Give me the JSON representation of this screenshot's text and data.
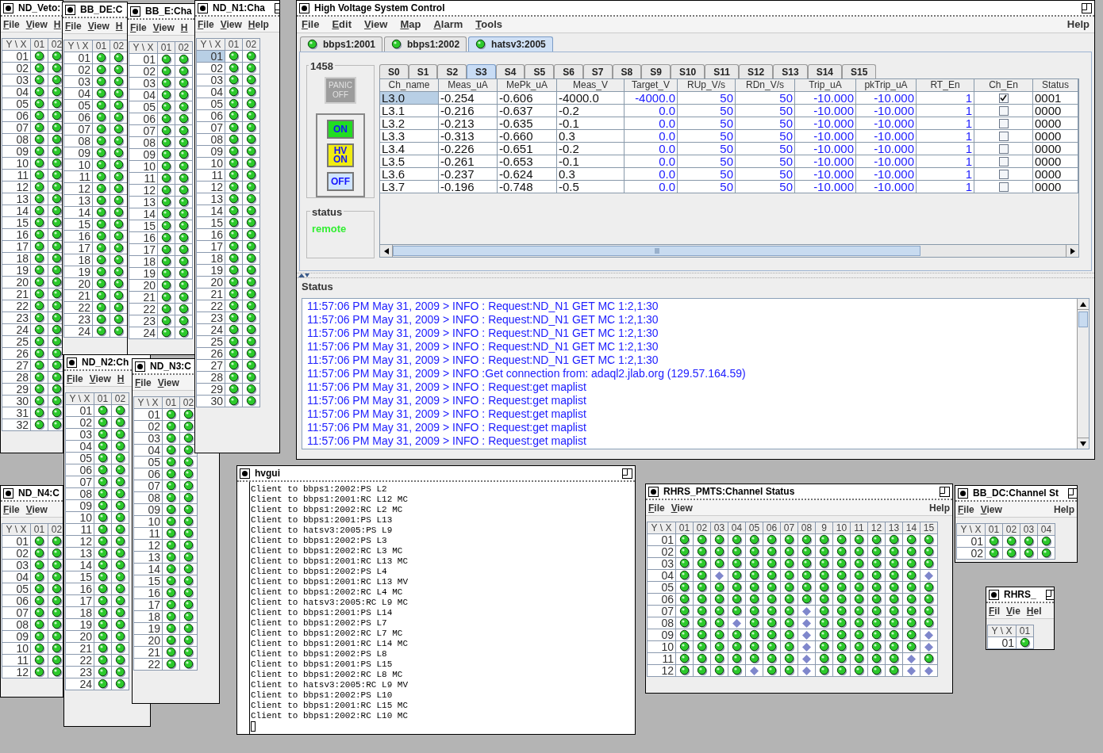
{
  "channel_windows": [
    {
      "title": "ND_Veto:",
      "menus": [
        "File",
        "View",
        "H"
      ],
      "corner": "Y \\ X",
      "columns": [
        "01",
        "02"
      ],
      "rows": [
        {
          "label": "01",
          "selected": false,
          "on": [
            true,
            true
          ]
        },
        {
          "label": "02",
          "selected": false,
          "on": [
            true,
            true
          ]
        },
        {
          "label": "03",
          "selected": false,
          "on": [
            true,
            true
          ]
        },
        {
          "label": "04",
          "selected": false,
          "on": [
            true,
            true
          ]
        },
        {
          "label": "05",
          "selected": false,
          "on": [
            true,
            true
          ]
        },
        {
          "label": "06",
          "selected": false,
          "on": [
            true,
            true
          ]
        },
        {
          "label": "07",
          "selected": false,
          "on": [
            true,
            true
          ]
        },
        {
          "label": "08",
          "selected": false,
          "on": [
            true,
            true
          ]
        },
        {
          "label": "09",
          "selected": false,
          "on": [
            true,
            true
          ]
        },
        {
          "label": "10",
          "selected": false,
          "on": [
            true,
            true
          ]
        },
        {
          "label": "11",
          "selected": false,
          "on": [
            true,
            true
          ]
        },
        {
          "label": "12",
          "selected": false,
          "on": [
            true,
            true
          ]
        },
        {
          "label": "13",
          "selected": false,
          "on": [
            true,
            true
          ]
        },
        {
          "label": "14",
          "selected": false,
          "on": [
            true,
            true
          ]
        },
        {
          "label": "15",
          "selected": false,
          "on": [
            true,
            true
          ]
        },
        {
          "label": "16",
          "selected": false,
          "on": [
            true,
            true
          ]
        },
        {
          "label": "17",
          "selected": false,
          "on": [
            true,
            true
          ]
        },
        {
          "label": "18",
          "selected": false,
          "on": [
            true,
            true
          ]
        },
        {
          "label": "19",
          "selected": false,
          "on": [
            true,
            true
          ]
        },
        {
          "label": "20",
          "selected": false,
          "on": [
            true,
            true
          ]
        },
        {
          "label": "21",
          "selected": false,
          "on": [
            true,
            true
          ]
        },
        {
          "label": "22",
          "selected": false,
          "on": [
            true,
            true
          ]
        },
        {
          "label": "23",
          "selected": false,
          "on": [
            true,
            true
          ]
        },
        {
          "label": "24",
          "selected": false,
          "on": [
            true,
            true
          ]
        },
        {
          "label": "25",
          "selected": false,
          "on": [
            true,
            true
          ]
        },
        {
          "label": "26",
          "selected": false,
          "on": [
            true,
            true
          ]
        },
        {
          "label": "27",
          "selected": false,
          "on": [
            true,
            true
          ]
        },
        {
          "label": "28",
          "selected": false,
          "on": [
            true,
            true
          ]
        },
        {
          "label": "29",
          "selected": false,
          "on": [
            true,
            true
          ]
        },
        {
          "label": "30",
          "selected": false,
          "on": [
            true,
            true
          ]
        },
        {
          "label": "31",
          "selected": false,
          "on": [
            true,
            true
          ]
        },
        {
          "label": "32",
          "selected": false,
          "on": [
            true,
            true
          ]
        }
      ]
    },
    {
      "title": "BB_DE:C",
      "menus": [
        "File",
        "View",
        "H"
      ],
      "corner": "Y \\ X",
      "columns": [
        "01",
        "02"
      ],
      "rows": [
        {
          "label": "01",
          "selected": false,
          "on": [
            true,
            true
          ]
        },
        {
          "label": "02",
          "selected": false,
          "on": [
            true,
            true
          ]
        },
        {
          "label": "03",
          "selected": false,
          "on": [
            true,
            true
          ]
        },
        {
          "label": "04",
          "selected": false,
          "on": [
            true,
            true
          ]
        },
        {
          "label": "05",
          "selected": false,
          "on": [
            true,
            true
          ]
        },
        {
          "label": "06",
          "selected": false,
          "on": [
            true,
            true
          ]
        },
        {
          "label": "07",
          "selected": false,
          "on": [
            true,
            true
          ]
        },
        {
          "label": "08",
          "selected": false,
          "on": [
            true,
            true
          ]
        },
        {
          "label": "09",
          "selected": false,
          "on": [
            true,
            true
          ]
        },
        {
          "label": "10",
          "selected": false,
          "on": [
            true,
            true
          ]
        },
        {
          "label": "11",
          "selected": false,
          "on": [
            true,
            true
          ]
        },
        {
          "label": "12",
          "selected": false,
          "on": [
            true,
            true
          ]
        },
        {
          "label": "13",
          "selected": false,
          "on": [
            true,
            true
          ]
        },
        {
          "label": "14",
          "selected": false,
          "on": [
            true,
            true
          ]
        },
        {
          "label": "15",
          "selected": false,
          "on": [
            true,
            true
          ]
        },
        {
          "label": "16",
          "selected": false,
          "on": [
            true,
            true
          ]
        },
        {
          "label": "17",
          "selected": false,
          "on": [
            true,
            true
          ]
        },
        {
          "label": "18",
          "selected": false,
          "on": [
            true,
            true
          ]
        },
        {
          "label": "19",
          "selected": false,
          "on": [
            true,
            true
          ]
        },
        {
          "label": "20",
          "selected": false,
          "on": [
            true,
            true
          ]
        },
        {
          "label": "21",
          "selected": false,
          "on": [
            true,
            true
          ]
        },
        {
          "label": "22",
          "selected": false,
          "on": [
            true,
            true
          ]
        },
        {
          "label": "23",
          "selected": false,
          "on": [
            true,
            true
          ]
        },
        {
          "label": "24",
          "selected": false,
          "on": [
            true,
            true
          ]
        }
      ]
    },
    {
      "title": "BB_E:Cha",
      "menus": [
        "File",
        "View",
        "H"
      ],
      "corner": "Y \\ X",
      "columns": [
        "01",
        "02"
      ],
      "rows": [
        {
          "label": "01",
          "selected": false,
          "on": [
            true,
            true
          ]
        },
        {
          "label": "02",
          "selected": false,
          "on": [
            true,
            true
          ]
        },
        {
          "label": "03",
          "selected": false,
          "on": [
            true,
            true
          ]
        },
        {
          "label": "04",
          "selected": false,
          "on": [
            true,
            true
          ]
        },
        {
          "label": "05",
          "selected": false,
          "on": [
            true,
            true
          ]
        },
        {
          "label": "06",
          "selected": false,
          "on": [
            true,
            true
          ]
        },
        {
          "label": "07",
          "selected": false,
          "on": [
            true,
            true
          ]
        },
        {
          "label": "08",
          "selected": false,
          "on": [
            true,
            true
          ]
        },
        {
          "label": "09",
          "selected": false,
          "on": [
            true,
            true
          ]
        },
        {
          "label": "10",
          "selected": false,
          "on": [
            true,
            true
          ]
        },
        {
          "label": "11",
          "selected": false,
          "on": [
            true,
            true
          ]
        },
        {
          "label": "12",
          "selected": false,
          "on": [
            true,
            true
          ]
        },
        {
          "label": "13",
          "selected": false,
          "on": [
            true,
            true
          ]
        },
        {
          "label": "14",
          "selected": false,
          "on": [
            true,
            true
          ]
        },
        {
          "label": "15",
          "selected": false,
          "on": [
            true,
            true
          ]
        },
        {
          "label": "16",
          "selected": false,
          "on": [
            true,
            true
          ]
        },
        {
          "label": "17",
          "selected": false,
          "on": [
            true,
            true
          ]
        },
        {
          "label": "18",
          "selected": false,
          "on": [
            true,
            true
          ]
        },
        {
          "label": "19",
          "selected": false,
          "on": [
            true,
            true
          ]
        },
        {
          "label": "20",
          "selected": false,
          "on": [
            true,
            true
          ]
        },
        {
          "label": "21",
          "selected": false,
          "on": [
            true,
            true
          ]
        },
        {
          "label": "22",
          "selected": false,
          "on": [
            true,
            true
          ]
        },
        {
          "label": "23",
          "selected": false,
          "on": [
            true,
            true
          ]
        },
        {
          "label": "24",
          "selected": false,
          "on": [
            true,
            true
          ]
        }
      ]
    },
    {
      "title": "ND_N1:Cha",
      "menus": [
        "File",
        "View",
        "Help"
      ],
      "corner": "Y \\ X",
      "columns": [
        "01",
        "02"
      ],
      "rows": [
        {
          "label": "01",
          "selected": true,
          "on": [
            true,
            true
          ]
        },
        {
          "label": "02",
          "selected": false,
          "on": [
            true,
            true
          ]
        },
        {
          "label": "03",
          "selected": false,
          "on": [
            true,
            true
          ]
        },
        {
          "label": "04",
          "selected": false,
          "on": [
            true,
            true
          ]
        },
        {
          "label": "05",
          "selected": false,
          "on": [
            true,
            true
          ]
        },
        {
          "label": "06",
          "selected": false,
          "on": [
            true,
            true
          ]
        },
        {
          "label": "07",
          "selected": false,
          "on": [
            true,
            true
          ]
        },
        {
          "label": "08",
          "selected": false,
          "on": [
            true,
            true
          ]
        },
        {
          "label": "09",
          "selected": false,
          "on": [
            true,
            true
          ]
        },
        {
          "label": "10",
          "selected": false,
          "on": [
            true,
            true
          ]
        },
        {
          "label": "11",
          "selected": false,
          "on": [
            true,
            true
          ]
        },
        {
          "label": "12",
          "selected": false,
          "on": [
            true,
            true
          ]
        },
        {
          "label": "13",
          "selected": false,
          "on": [
            true,
            true
          ]
        },
        {
          "label": "14",
          "selected": false,
          "on": [
            true,
            true
          ]
        },
        {
          "label": "15",
          "selected": false,
          "on": [
            true,
            true
          ]
        },
        {
          "label": "16",
          "selected": false,
          "on": [
            true,
            true
          ]
        },
        {
          "label": "17",
          "selected": false,
          "on": [
            true,
            true
          ]
        },
        {
          "label": "18",
          "selected": false,
          "on": [
            true,
            true
          ]
        },
        {
          "label": "19",
          "selected": false,
          "on": [
            true,
            true
          ]
        },
        {
          "label": "20",
          "selected": false,
          "on": [
            true,
            true
          ]
        },
        {
          "label": "21",
          "selected": false,
          "on": [
            true,
            true
          ]
        },
        {
          "label": "22",
          "selected": false,
          "on": [
            true,
            true
          ]
        },
        {
          "label": "23",
          "selected": false,
          "on": [
            true,
            true
          ]
        },
        {
          "label": "24",
          "selected": false,
          "on": [
            true,
            true
          ]
        },
        {
          "label": "25",
          "selected": false,
          "on": [
            true,
            true
          ]
        },
        {
          "label": "26",
          "selected": false,
          "on": [
            true,
            true
          ]
        },
        {
          "label": "27",
          "selected": false,
          "on": [
            true,
            true
          ]
        },
        {
          "label": "28",
          "selected": false,
          "on": [
            true,
            true
          ]
        },
        {
          "label": "29",
          "selected": false,
          "on": [
            true,
            true
          ]
        },
        {
          "label": "30",
          "selected": false,
          "on": [
            true,
            true
          ]
        }
      ]
    },
    {
      "title": "ND_N4:C",
      "menus": [
        "File",
        "View"
      ],
      "corner": "Y \\ X",
      "columns": [
        "01",
        "02"
      ],
      "rows": [
        {
          "label": "01",
          "selected": false,
          "on": [
            true,
            true
          ]
        },
        {
          "label": "02",
          "selected": false,
          "on": [
            true,
            true
          ]
        },
        {
          "label": "03",
          "selected": false,
          "on": [
            true,
            true
          ]
        },
        {
          "label": "04",
          "selected": false,
          "on": [
            true,
            true
          ]
        },
        {
          "label": "05",
          "selected": false,
          "on": [
            true,
            true
          ]
        },
        {
          "label": "06",
          "selected": false,
          "on": [
            true,
            true
          ]
        },
        {
          "label": "07",
          "selected": false,
          "on": [
            true,
            true
          ]
        },
        {
          "label": "08",
          "selected": false,
          "on": [
            true,
            true
          ]
        },
        {
          "label": "09",
          "selected": false,
          "on": [
            true,
            true
          ]
        },
        {
          "label": "10",
          "selected": false,
          "on": [
            true,
            true
          ]
        },
        {
          "label": "11",
          "selected": false,
          "on": [
            true,
            true
          ]
        },
        {
          "label": "12",
          "selected": false,
          "on": [
            true,
            true
          ]
        }
      ]
    },
    {
      "title": "ND_N2:Ch",
      "menus": [
        "File",
        "View",
        "H"
      ],
      "corner": "Y \\ X",
      "columns": [
        "01",
        "02"
      ],
      "rows": [
        {
          "label": "01",
          "selected": false,
          "on": [
            true,
            true
          ]
        },
        {
          "label": "02",
          "selected": false,
          "on": [
            true,
            true
          ]
        },
        {
          "label": "03",
          "selected": false,
          "on": [
            true,
            true
          ]
        },
        {
          "label": "04",
          "selected": false,
          "on": [
            true,
            true
          ]
        },
        {
          "label": "05",
          "selected": false,
          "on": [
            true,
            true
          ]
        },
        {
          "label": "06",
          "selected": false,
          "on": [
            true,
            true
          ]
        },
        {
          "label": "07",
          "selected": false,
          "on": [
            true,
            true
          ]
        },
        {
          "label": "08",
          "selected": false,
          "on": [
            true,
            true
          ]
        },
        {
          "label": "09",
          "selected": false,
          "on": [
            true,
            true
          ]
        },
        {
          "label": "10",
          "selected": false,
          "on": [
            true,
            true
          ]
        },
        {
          "label": "11",
          "selected": false,
          "on": [
            true,
            true
          ]
        },
        {
          "label": "12",
          "selected": false,
          "on": [
            true,
            true
          ]
        },
        {
          "label": "13",
          "selected": false,
          "on": [
            true,
            true
          ]
        },
        {
          "label": "14",
          "selected": false,
          "on": [
            true,
            true
          ]
        },
        {
          "label": "15",
          "selected": false,
          "on": [
            true,
            true
          ]
        },
        {
          "label": "16",
          "selected": false,
          "on": [
            true,
            true
          ]
        },
        {
          "label": "17",
          "selected": false,
          "on": [
            true,
            true
          ]
        },
        {
          "label": "18",
          "selected": false,
          "on": [
            true,
            true
          ]
        },
        {
          "label": "19",
          "selected": false,
          "on": [
            true,
            true
          ]
        },
        {
          "label": "20",
          "selected": false,
          "on": [
            true,
            true
          ]
        },
        {
          "label": "21",
          "selected": false,
          "on": [
            true,
            true
          ]
        },
        {
          "label": "22",
          "selected": false,
          "on": [
            true,
            true
          ]
        },
        {
          "label": "23",
          "selected": false,
          "on": [
            true,
            true
          ]
        },
        {
          "label": "24",
          "selected": false,
          "on": [
            true,
            true
          ]
        }
      ]
    },
    {
      "title": "ND_N3:C",
      "menus": [
        "File",
        "View"
      ],
      "corner": "Y \\ X",
      "columns": [
        "01",
        "02"
      ],
      "rows": [
        {
          "label": "01",
          "selected": false,
          "on": [
            true,
            true
          ]
        },
        {
          "label": "02",
          "selected": false,
          "on": [
            true,
            true
          ]
        },
        {
          "label": "03",
          "selected": false,
          "on": [
            true,
            true
          ]
        },
        {
          "label": "04",
          "selected": false,
          "on": [
            true,
            true
          ]
        },
        {
          "label": "05",
          "selected": false,
          "on": [
            true,
            true
          ]
        },
        {
          "label": "06",
          "selected": false,
          "on": [
            true,
            true
          ]
        },
        {
          "label": "07",
          "selected": false,
          "on": [
            true,
            true
          ]
        },
        {
          "label": "08",
          "selected": false,
          "on": [
            true,
            true
          ]
        },
        {
          "label": "09",
          "selected": false,
          "on": [
            true,
            true
          ]
        },
        {
          "label": "10",
          "selected": false,
          "on": [
            true,
            true
          ]
        },
        {
          "label": "11",
          "selected": false,
          "on": [
            true,
            true
          ]
        },
        {
          "label": "12",
          "selected": false,
          "on": [
            true,
            true
          ]
        },
        {
          "label": "13",
          "selected": false,
          "on": [
            true,
            true
          ]
        },
        {
          "label": "14",
          "selected": false,
          "on": [
            true,
            true
          ]
        },
        {
          "label": "15",
          "selected": false,
          "on": [
            true,
            true
          ]
        },
        {
          "label": "16",
          "selected": false,
          "on": [
            true,
            true
          ]
        },
        {
          "label": "17",
          "selected": false,
          "on": [
            true,
            true
          ]
        },
        {
          "label": "18",
          "selected": false,
          "on": [
            true,
            true
          ]
        },
        {
          "label": "19",
          "selected": false,
          "on": [
            true,
            true
          ]
        },
        {
          "label": "20",
          "selected": false,
          "on": [
            true,
            true
          ]
        },
        {
          "label": "21",
          "selected": false,
          "on": [
            true,
            true
          ]
        },
        {
          "label": "22",
          "selected": false,
          "on": [
            true,
            true
          ]
        }
      ]
    },
    {
      "title": "RHRS_PMTS:Channel Status",
      "menus": [
        "File",
        "View"
      ],
      "help": "Help",
      "corner": "Y \\ X",
      "columns": [
        "01",
        "02",
        "03",
        "04",
        "05",
        "06",
        "07",
        "08",
        "9",
        "10",
        "11",
        "12",
        "13",
        "14",
        "15"
      ],
      "rows": [
        {
          "label": "01",
          "selected": false,
          "on": [
            true,
            true,
            true,
            true,
            true,
            true,
            true,
            true,
            true,
            true,
            true,
            true,
            true,
            true,
            true
          ]
        },
        {
          "label": "02",
          "selected": false,
          "on": [
            true,
            true,
            true,
            true,
            true,
            true,
            true,
            true,
            true,
            true,
            true,
            true,
            true,
            true,
            true
          ]
        },
        {
          "label": "03",
          "selected": false,
          "on": [
            true,
            true,
            true,
            true,
            true,
            true,
            true,
            true,
            true,
            true,
            true,
            true,
            true,
            true,
            true
          ]
        },
        {
          "label": "04",
          "selected": false,
          "on": [
            true,
            true,
            false,
            true,
            true,
            true,
            true,
            true,
            true,
            true,
            true,
            true,
            true,
            true,
            false
          ]
        },
        {
          "label": "05",
          "selected": false,
          "on": [
            true,
            true,
            true,
            true,
            true,
            true,
            true,
            true,
            true,
            true,
            true,
            true,
            true,
            true,
            true
          ]
        },
        {
          "label": "06",
          "selected": false,
          "on": [
            true,
            true,
            true,
            true,
            true,
            true,
            true,
            true,
            true,
            true,
            true,
            true,
            true,
            true,
            true
          ]
        },
        {
          "label": "07",
          "selected": false,
          "on": [
            true,
            true,
            true,
            true,
            true,
            true,
            true,
            false,
            true,
            true,
            true,
            true,
            true,
            true,
            true
          ]
        },
        {
          "label": "08",
          "selected": false,
          "on": [
            true,
            true,
            true,
            false,
            true,
            true,
            true,
            false,
            true,
            true,
            true,
            true,
            true,
            true,
            true
          ]
        },
        {
          "label": "09",
          "selected": false,
          "on": [
            true,
            true,
            true,
            true,
            true,
            true,
            true,
            false,
            true,
            true,
            true,
            true,
            true,
            true,
            false
          ]
        },
        {
          "label": "10",
          "selected": false,
          "on": [
            true,
            true,
            true,
            true,
            true,
            true,
            true,
            false,
            true,
            true,
            true,
            true,
            true,
            true,
            false
          ]
        },
        {
          "label": "11",
          "selected": false,
          "on": [
            true,
            true,
            true,
            true,
            true,
            true,
            true,
            false,
            true,
            true,
            true,
            true,
            true,
            false,
            true
          ]
        },
        {
          "label": "12",
          "selected": false,
          "on": [
            true,
            true,
            true,
            true,
            false,
            true,
            true,
            false,
            true,
            true,
            true,
            true,
            true,
            false,
            false
          ]
        }
      ]
    },
    {
      "title": "BB_DC:Channel St",
      "menus": [
        "File",
        "View"
      ],
      "help": "Help",
      "corner": "Y \\ X",
      "columns": [
        "01",
        "02",
        "03",
        "04"
      ],
      "rows": [
        {
          "label": "01",
          "selected": false,
          "on": [
            true,
            true,
            true,
            true
          ]
        },
        {
          "label": "02",
          "selected": false,
          "on": [
            true,
            true,
            true,
            true
          ]
        }
      ]
    },
    {
      "title": "RHRS_",
      "menus": [
        "Fil",
        "Vie",
        "Hel"
      ],
      "corner": "Y \\ X",
      "columns": [
        "01"
      ],
      "rows": [
        {
          "label": "01",
          "selected": false,
          "on": [
            true
          ]
        }
      ]
    }
  ],
  "main_window": {
    "title": "High Voltage System Control",
    "menus": [
      "File",
      "Edit",
      "View",
      "Map",
      "Alarm",
      "Tools"
    ],
    "help": "Help",
    "servers": [
      {
        "label": "bbps1:2001",
        "selected": false
      },
      {
        "label": "bbps1:2002",
        "selected": false
      },
      {
        "label": "hatsv3:2005",
        "selected": true
      }
    ],
    "crate": {
      "label": "1458",
      "panic": {
        "lines": [
          "PANIC",
          "OFF"
        ],
        "disabled": true
      },
      "buttons": [
        {
          "kind": "on",
          "lines": [
            "ON"
          ]
        },
        {
          "kind": "hv",
          "lines": [
            "HV",
            "ON"
          ]
        },
        {
          "kind": "off",
          "lines": [
            "OFF"
          ]
        }
      ],
      "status_label": "status",
      "status_value": "remote"
    },
    "slots": [
      {
        "label": "S0",
        "selected": false
      },
      {
        "label": "S1",
        "selected": false
      },
      {
        "label": "S2",
        "selected": false
      },
      {
        "label": "S3",
        "selected": true
      },
      {
        "label": "S4",
        "selected": false
      },
      {
        "label": "S5",
        "selected": false
      },
      {
        "label": "S6",
        "selected": false
      },
      {
        "label": "S7",
        "selected": false
      },
      {
        "label": "S8",
        "selected": false
      },
      {
        "label": "S9",
        "selected": false
      },
      {
        "label": "S10",
        "selected": false
      },
      {
        "label": "S11",
        "selected": false
      },
      {
        "label": "S12",
        "selected": false
      },
      {
        "label": "S13",
        "selected": false
      },
      {
        "label": "S14",
        "selected": false
      },
      {
        "label": "S15",
        "selected": false
      }
    ],
    "table": {
      "columns": [
        "Ch_name",
        "Meas_uA",
        "MePk_uA",
        "Meas_V",
        "Target_V",
        "RUp_V/s",
        "RDn_V/s",
        "Trip_uA",
        "pkTrip_uA",
        "RT_En",
        "Ch_En",
        "Status"
      ],
      "rows": [
        {
          "selected": true,
          "cells": [
            "L3.0",
            "-0.254",
            "-0.606",
            "-4000.0",
            "-4000.0",
            "50",
            "50",
            "-10.000",
            "-10.000",
            "1"
          ],
          "ch_en": true,
          "status": "0001"
        },
        {
          "selected": false,
          "cells": [
            "L3.1",
            "-0.216",
            "-0.637",
            "-0.2",
            "0.0",
            "50",
            "50",
            "-10.000",
            "-10.000",
            "1"
          ],
          "ch_en": false,
          "status": "0000"
        },
        {
          "selected": false,
          "cells": [
            "L3.2",
            "-0.213",
            "-0.635",
            "-0.1",
            "0.0",
            "50",
            "50",
            "-10.000",
            "-10.000",
            "1"
          ],
          "ch_en": false,
          "status": "0000"
        },
        {
          "selected": false,
          "cells": [
            "L3.3",
            "-0.313",
            "-0.660",
            "0.3",
            "0.0",
            "50",
            "50",
            "-10.000",
            "-10.000",
            "1"
          ],
          "ch_en": false,
          "status": "0000"
        },
        {
          "selected": false,
          "cells": [
            "L3.4",
            "-0.226",
            "-0.651",
            "-0.2",
            "0.0",
            "50",
            "50",
            "-10.000",
            "-10.000",
            "1"
          ],
          "ch_en": false,
          "status": "0000"
        },
        {
          "selected": false,
          "cells": [
            "L3.5",
            "-0.261",
            "-0.653",
            "-0.1",
            "0.0",
            "50",
            "50",
            "-10.000",
            "-10.000",
            "1"
          ],
          "ch_en": false,
          "status": "0000"
        },
        {
          "selected": false,
          "cells": [
            "L3.6",
            "-0.237",
            "-0.624",
            "0.3",
            "0.0",
            "50",
            "50",
            "-10.000",
            "-10.000",
            "1"
          ],
          "ch_en": false,
          "status": "0000"
        },
        {
          "selected": false,
          "cells": [
            "L3.7",
            "-0.196",
            "-0.748",
            "-0.5",
            "0.0",
            "50",
            "50",
            "-10.000",
            "-10.000",
            "1"
          ],
          "ch_en": false,
          "status": "0000"
        }
      ]
    },
    "status_log": {
      "label": "Status",
      "lines": [
        "11:57:06 PM May 31, 2009 > INFO : Request:ND_N1 GET MC 1:2,1:30",
        "11:57:06 PM May 31, 2009 > INFO : Request:ND_N1 GET MC 1:2,1:30",
        "11:57:06 PM May 31, 2009 > INFO : Request:ND_N1 GET MC 1:2,1:30",
        "11:57:06 PM May 31, 2009 > INFO : Request:ND_N1 GET MC 1:2,1:30",
        "11:57:06 PM May 31, 2009 > INFO : Request:ND_N1 GET MC 1:2,1:30",
        "11:57:06 PM May 31, 2009 > INFO :Get connection from: adaql2.jlab.org (129.57.164.59)",
        "11:57:06 PM May 31, 2009 > INFO : Request:get maplist",
        "11:57:06 PM May 31, 2009 > INFO : Request:get maplist",
        "11:57:06 PM May 31, 2009 > INFO : Request:get maplist",
        "11:57:06 PM May 31, 2009 > INFO : Request:get maplist",
        "11:57:06 PM May 31, 2009 > INFO : Request:get maplist"
      ]
    }
  },
  "terminal": {
    "title": "hvgui",
    "lines": [
      "Client to bbps1:2002:PS L2",
      "Client to bbps1:2001:RC L12 MC",
      "Client to bbps1:2002:RC L2 MC",
      "Client to bbps1:2001:PS L13",
      "Client to hatsv3:2005:PS L9",
      "Client to bbps1:2002:PS L3",
      "Client to bbps1:2002:RC L3 MC",
      "Client to bbps1:2001:RC L13 MC",
      "Client to bbps1:2002:PS L4",
      "Client to bbps1:2001:RC L13 MV",
      "Client to bbps1:2002:RC L4 MC",
      "Client to hatsv3:2005:RC L9 MC",
      "Client to bbps1:2001:PS L14",
      "Client to bbps1:2002:PS L7",
      "Client to bbps1:2002:RC L7 MC",
      "Client to bbps1:2001:RC L14 MC",
      "Client to bbps1:2002:PS L8",
      "Client to bbps1:2001:PS L15",
      "Client to bbps1:2002:RC L8 MC",
      "Client to hatsv3:2005:RC L9 MV",
      "Client to bbps1:2002:PS L10",
      "Client to bbps1:2001:RC L15 MC",
      "Client to bbps1:2002:RC L10 MC"
    ]
  }
}
